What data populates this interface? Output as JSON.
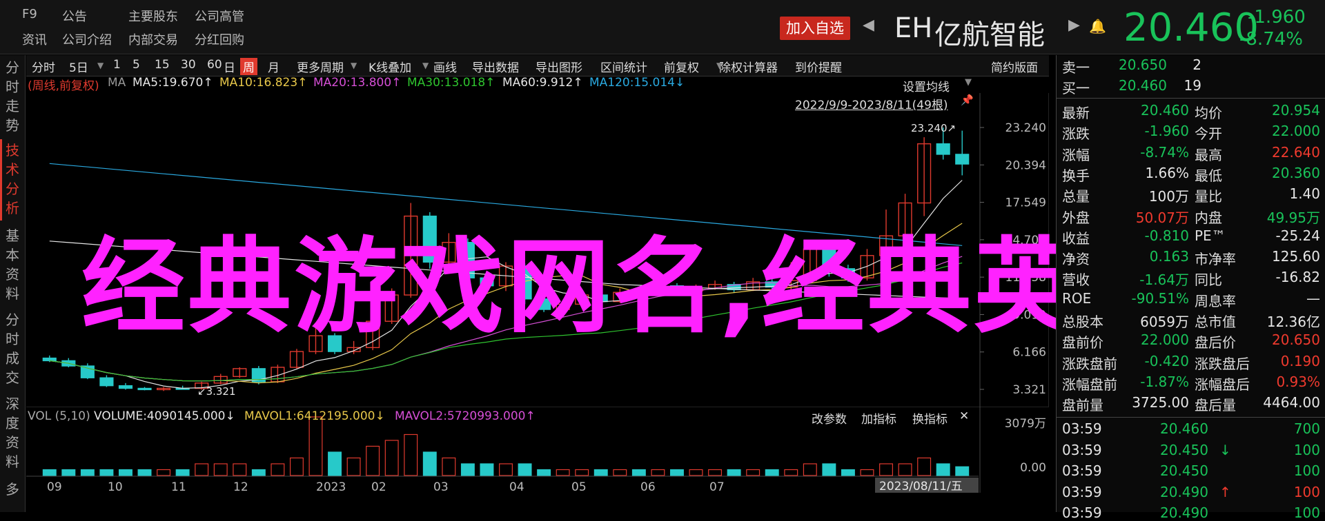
{
  "header": {
    "nav_row1": [
      "F9",
      "公告",
      "主要股东",
      "公司高管"
    ],
    "nav_row2": [
      "资讯",
      "公司介绍",
      "内部交易",
      "分红回购"
    ],
    "add_watch_label": "加入自选",
    "code": "EH",
    "name": "亿航智能",
    "price": "20.460",
    "change": "-1.960",
    "change_pct": "-8.74%"
  },
  "left_tabs": [
    "分时走势",
    "技术分析",
    "基本资料",
    "分时成交",
    "深度资料",
    "多"
  ],
  "toolbar": {
    "items": [
      "分时",
      "5日",
      "1",
      "5",
      "15",
      "30",
      "60",
      "日",
      "周",
      "月",
      "更多周期",
      "K线叠加",
      "画线",
      "导出数据",
      "导出图形",
      "区间统计",
      "前复权",
      "除权计算器",
      "到价提醒"
    ],
    "active": "周",
    "right": "简约版面"
  },
  "ma_line": {
    "prefix": "(周线,前复权)",
    "ma": "MA",
    "ma5": "MA5:19.670↑",
    "ma10": "MA10:16.823↑",
    "ma20": "MA20:13.800↑",
    "ma30": "MA30:13.018↑",
    "ma60": "MA60:9.912↑",
    "ma120": "MA120:15.014↓"
  },
  "chart_controls": {
    "settings": "设置均线",
    "range": "2022/9/9-2023/8/11(49根)"
  },
  "overlay_text": "经典游戏网名,经典英",
  "chart_data": {
    "type": "candlestick",
    "y_ticks": [
      "23.240",
      "20.394",
      "17.549",
      "14.703",
      "11.858",
      "9.012",
      "6.166",
      "3.321"
    ],
    "y_tick_values": [
      23.24,
      20.394,
      17.549,
      14.703,
      11.858,
      9.012,
      6.166,
      3.321
    ],
    "ylim": [
      3.321,
      23.24
    ],
    "high_label": "23.240",
    "low_label": "3.321",
    "x_labels": [
      "09",
      "10",
      "11",
      "12",
      "2023",
      "02",
      "03",
      "04",
      "05",
      "06",
      "07"
    ],
    "current_date": "2023/08/11/五",
    "candles": [
      {
        "o": 5.7,
        "c": 5.5,
        "h": 5.9,
        "l": 5.4
      },
      {
        "o": 5.5,
        "c": 5.1,
        "h": 5.7,
        "l": 5.0
      },
      {
        "o": 5.1,
        "c": 4.2,
        "h": 5.3,
        "l": 4.1
      },
      {
        "o": 4.2,
        "c": 3.6,
        "h": 4.4,
        "l": 3.5
      },
      {
        "o": 3.6,
        "c": 3.4,
        "h": 3.8,
        "l": 3.3
      },
      {
        "o": 3.4,
        "c": 3.3,
        "h": 3.5,
        "l": 3.25
      },
      {
        "o": 3.3,
        "c": 3.4,
        "h": 3.5,
        "l": 3.2
      },
      {
        "o": 3.4,
        "c": 3.321,
        "h": 3.6,
        "l": 3.321
      },
      {
        "o": 3.4,
        "c": 3.8,
        "h": 3.9,
        "l": 3.3
      },
      {
        "o": 3.8,
        "c": 4.3,
        "h": 4.5,
        "l": 3.7
      },
      {
        "o": 4.3,
        "c": 4.9,
        "h": 5.0,
        "l": 4.2
      },
      {
        "o": 4.9,
        "c": 3.9,
        "h": 5.1,
        "l": 3.7
      },
      {
        "o": 3.9,
        "c": 5.0,
        "h": 5.2,
        "l": 3.8
      },
      {
        "o": 5.0,
        "c": 6.2,
        "h": 6.4,
        "l": 4.9
      },
      {
        "o": 6.2,
        "c": 7.4,
        "h": 8.2,
        "l": 6.0
      },
      {
        "o": 7.4,
        "c": 6.2,
        "h": 7.6,
        "l": 6.0
      },
      {
        "o": 6.2,
        "c": 6.5,
        "h": 7.0,
        "l": 6.0
      },
      {
        "o": 6.5,
        "c": 8.5,
        "h": 8.9,
        "l": 6.3
      },
      {
        "o": 8.5,
        "c": 10.5,
        "h": 11.0,
        "l": 8.3
      },
      {
        "o": 10.5,
        "c": 16.5,
        "h": 17.5,
        "l": 10.3
      },
      {
        "o": 16.5,
        "c": 13.0,
        "h": 16.8,
        "l": 12.5
      },
      {
        "o": 13.0,
        "c": 14.5,
        "h": 15.2,
        "l": 12.7
      },
      {
        "o": 14.5,
        "c": 11.8,
        "h": 14.8,
        "l": 11.5
      },
      {
        "o": 11.8,
        "c": 11.2,
        "h": 12.3,
        "l": 10.9
      },
      {
        "o": 11.2,
        "c": 12.7,
        "h": 13.0,
        "l": 10.8
      },
      {
        "o": 12.7,
        "c": 10.2,
        "h": 12.9,
        "l": 9.8
      },
      {
        "o": 10.2,
        "c": 9.4,
        "h": 10.5,
        "l": 9.2
      },
      {
        "o": 9.4,
        "c": 9.8,
        "h": 10.1,
        "l": 9.0
      },
      {
        "o": 9.8,
        "c": 10.5,
        "h": 10.8,
        "l": 9.6
      },
      {
        "o": 10.5,
        "c": 10.0,
        "h": 10.8,
        "l": 9.8
      },
      {
        "o": 10.0,
        "c": 10.7,
        "h": 11.0,
        "l": 9.9
      },
      {
        "o": 10.7,
        "c": 10.6,
        "h": 11.0,
        "l": 10.4
      },
      {
        "o": 10.6,
        "c": 11.2,
        "h": 11.5,
        "l": 10.5
      },
      {
        "o": 11.2,
        "c": 10.8,
        "h": 11.4,
        "l": 10.6
      },
      {
        "o": 10.8,
        "c": 11.0,
        "h": 11.3,
        "l": 10.6
      },
      {
        "o": 11.0,
        "c": 11.3,
        "h": 11.6,
        "l": 10.9
      },
      {
        "o": 11.3,
        "c": 10.9,
        "h": 11.5,
        "l": 10.7
      },
      {
        "o": 10.9,
        "c": 11.5,
        "h": 11.8,
        "l": 10.8
      },
      {
        "o": 11.5,
        "c": 11.1,
        "h": 11.7,
        "l": 10.9
      },
      {
        "o": 11.1,
        "c": 11.6,
        "h": 13.0,
        "l": 10.9
      },
      {
        "o": 11.6,
        "c": 14.0,
        "h": 14.5,
        "l": 11.4
      },
      {
        "o": 14.0,
        "c": 12.5,
        "h": 14.2,
        "l": 11.9
      },
      {
        "o": 12.5,
        "c": 11.8,
        "h": 12.8,
        "l": 11.5
      },
      {
        "o": 11.8,
        "c": 13.5,
        "h": 14.0,
        "l": 11.6
      },
      {
        "o": 13.5,
        "c": 15.0,
        "h": 17.0,
        "l": 13.2
      },
      {
        "o": 15.0,
        "c": 17.5,
        "h": 18.2,
        "l": 14.8
      },
      {
        "o": 17.5,
        "c": 22.0,
        "h": 22.5,
        "l": 16.5
      },
      {
        "o": 22.0,
        "c": 21.2,
        "h": 23.24,
        "l": 20.8
      },
      {
        "o": 21.2,
        "c": 20.46,
        "h": 23.0,
        "l": 19.6
      }
    ]
  },
  "volume": {
    "title": "VOL (5,10)",
    "volume": "VOLUME:4090145.000↓",
    "mavol1": "MAVOL1:6412195.000↓",
    "mavol2": "MAVOL2:5720993.000↑",
    "buttons": [
      "改参数",
      "加指标",
      "换指标"
    ],
    "close": "✕",
    "y_top": "3079万",
    "y_bottom": "0.00"
  },
  "right_panel": {
    "sell1": {
      "label": "卖一",
      "price": "20.650",
      "vol": "2"
    },
    "buy1": {
      "label": "买一",
      "price": "20.460",
      "vol": "19"
    },
    "stats": [
      [
        "最新",
        "20.460",
        "均价",
        "20.954"
      ],
      [
        "涨跌",
        "-1.960",
        "今开",
        "22.000"
      ],
      [
        "涨幅",
        "-8.74%",
        "最高",
        "22.640"
      ],
      [
        "换手",
        "1.66%",
        "最低",
        "20.360"
      ],
      [
        "总量",
        "100万",
        "量比",
        "1.40"
      ],
      [
        "外盘",
        "50.07万",
        "内盘",
        "49.95万"
      ],
      [
        "收益",
        "-0.810",
        "PE™",
        "-25.24"
      ],
      [
        "净资",
        "0.163",
        "市净率",
        "125.60"
      ],
      [
        "营收",
        "-1.64万",
        "同比",
        "-16.82"
      ],
      [
        "ROE",
        "-90.51%",
        "周息率",
        "—"
      ],
      [
        "总股本",
        "6059万",
        "总市值",
        "12.36亿"
      ],
      [
        "盘前价",
        "22.000",
        "盘后价",
        "20.650"
      ],
      [
        "涨跌盘前",
        "-0.420",
        "涨跌盘后",
        "0.190"
      ],
      [
        "涨幅盘前",
        "-1.87%",
        "涨幅盘后",
        "0.93%"
      ],
      [
        "盘前量",
        "3725.00",
        "盘后量",
        "4464.00"
      ]
    ],
    "trades": [
      [
        "03:59",
        "20.460",
        "",
        "700"
      ],
      [
        "03:59",
        "20.450",
        "↓",
        "100"
      ],
      [
        "03:59",
        "20.450",
        "",
        "100"
      ],
      [
        "03:59",
        "20.490",
        "↑",
        "100"
      ],
      [
        "03:59",
        "20.490",
        "",
        "100"
      ]
    ]
  },
  "colors": {
    "up": "#e03a2e",
    "down": "#27c9c9",
    "overlay": "#ff22ff",
    "ma5": "#e6e6e6",
    "ma10": "#e8c84a",
    "ma20": "#d64fd6",
    "ma30": "#2fc42f",
    "ma60": "#e6e6e6",
    "ma120": "#2aa9e0"
  }
}
